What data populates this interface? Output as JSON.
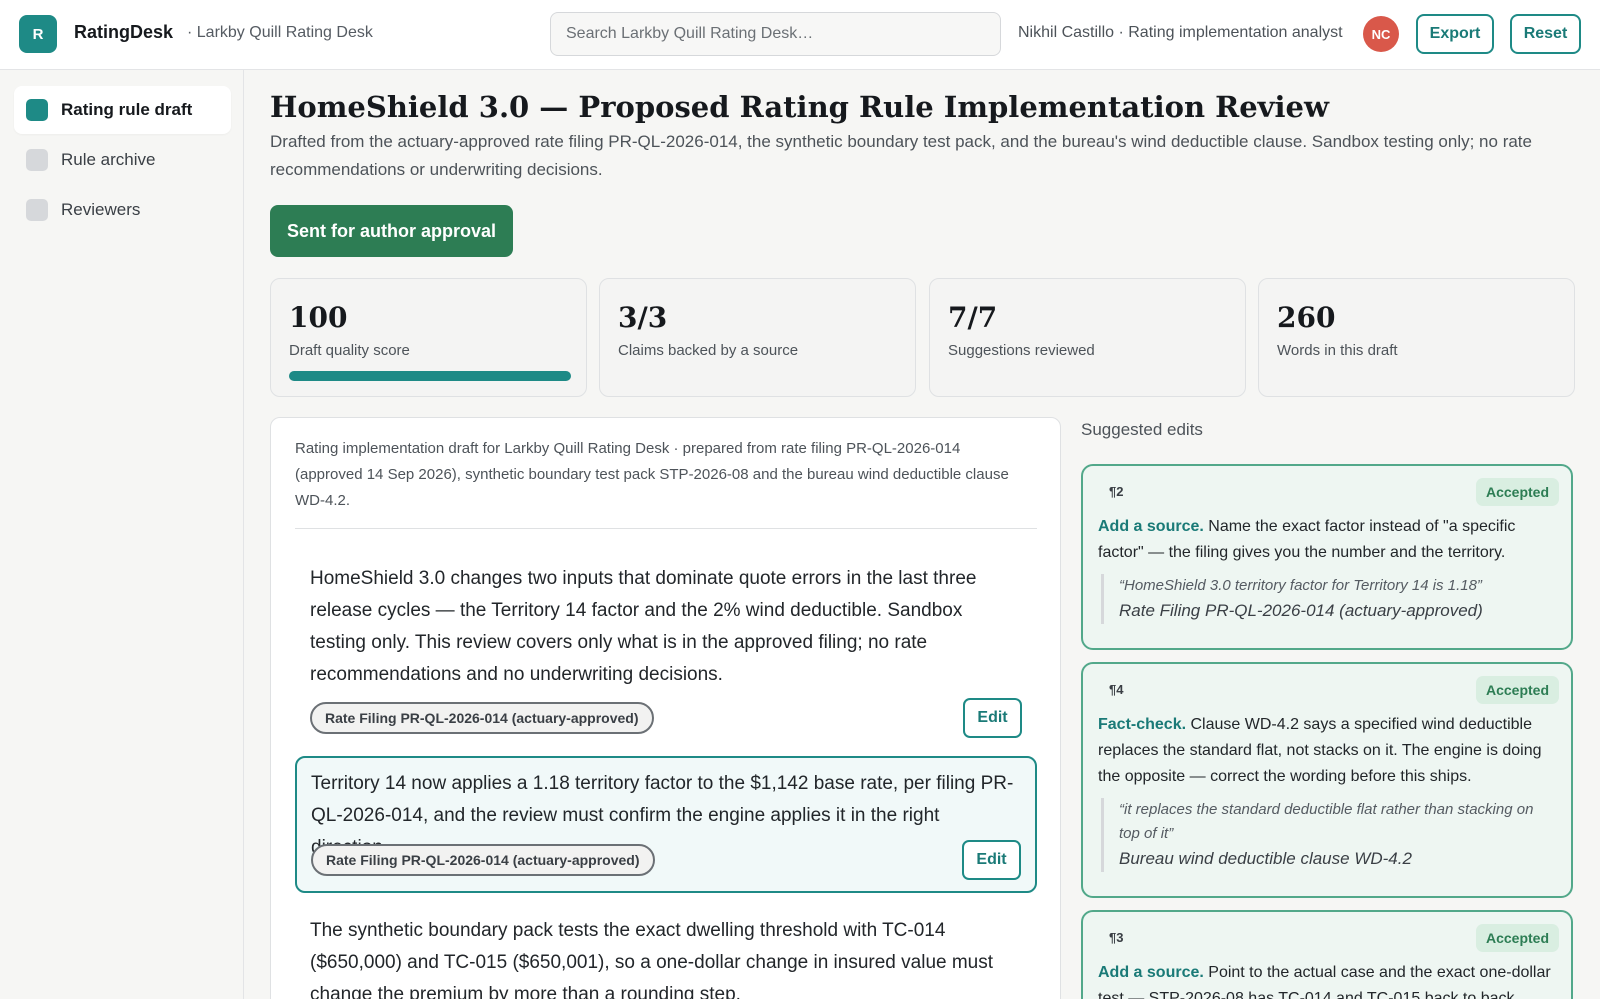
{
  "header": {
    "logo_letter": "R",
    "app_name": "RatingDesk",
    "app_context": "· Larkby Quill Rating Desk",
    "search_placeholder": "Search Larkby Quill Rating Desk…",
    "user_label": "Nikhil Castillo · Rating implementation analyst",
    "avatar_initials": "NC",
    "export_label": "Export",
    "reset_label": "Reset"
  },
  "sidebar": {
    "items": [
      {
        "label": "Rating rule draft",
        "active": true
      },
      {
        "label": "Rule archive",
        "active": false
      },
      {
        "label": "Reviewers",
        "active": false
      }
    ]
  },
  "main": {
    "title": "HomeShield 3.0 — Proposed Rating Rule Implementation Review",
    "subtitle": "Drafted from the actuary-approved rate filing PR-QL-2026-014, the synthetic boundary test pack, and the bureau's wind deductible clause. Sandbox testing only; no rate recommendations or underwriting decisions.",
    "status_button": "Sent for author approval",
    "stats": [
      {
        "value": "100",
        "label": "Draft quality score",
        "progress": 1.0
      },
      {
        "value": "3/3",
        "label": "Claims backed by a source"
      },
      {
        "value": "7/7",
        "label": "Suggestions reviewed"
      },
      {
        "value": "260",
        "label": "Words in this draft"
      }
    ]
  },
  "draft": {
    "meta": "Rating implementation draft for Larkby Quill Rating Desk · prepared from rate filing PR-QL-2026-014 (approved 14 Sep 2026), synthetic boundary test pack STP-2026-08 and the bureau wind deductible clause WD-4.2.",
    "edit_label": "Edit",
    "paragraphs": [
      {
        "text": "HomeShield 3.0 changes two inputs that dominate quote errors in the last three release cycles — the Territory 14 factor and the 2% wind deductible. Sandbox testing only. This review covers only what is in the approved filing; no rate recommendations and no underwriting decisions.",
        "source": "Rate Filing PR-QL-2026-014 (actuary-approved)"
      },
      {
        "text": "Territory 14 now applies a 1.18 territory factor to the $1,142 base rate, per filing PR-QL-2026-014, and the review must confirm the engine applies it in the right direction.",
        "source": "Rate Filing PR-QL-2026-014 (actuary-approved)"
      },
      {
        "text": "The synthetic boundary pack tests the exact dwelling threshold with TC-014 ($650,000) and TC-015 ($650,001), so a one-dollar change in insured value must change the premium by more than a rounding step."
      }
    ]
  },
  "suggestions": {
    "heading": "Suggested edits",
    "cards": [
      {
        "para": "¶2",
        "status": "Accepted",
        "kind": "Add a source.",
        "body": "Name the exact factor instead of \"a specific factor\" — the filing gives you the number and the territory.",
        "quote": "“HomeShield 3.0 territory factor for Territory 14 is 1.18”",
        "source": "Rate Filing PR-QL-2026-014 (actuary-approved)"
      },
      {
        "para": "¶4",
        "status": "Accepted",
        "kind": "Fact-check.",
        "body": "Clause WD-4.2 says a specified wind deductible replaces the standard flat, not stacks on it. The engine is doing the opposite — correct the wording before this ships.",
        "quote": "“it replaces the standard deductible flat rather than stacking on top of it”",
        "source": "Bureau wind deductible clause WD-4.2"
      },
      {
        "para": "¶3",
        "status": "Accepted",
        "kind": "Add a source.",
        "body": "Point to the actual case and the exact one-dollar test — STP-2026-08 has TC-014 and TC-015 back to back."
      }
    ]
  }
}
